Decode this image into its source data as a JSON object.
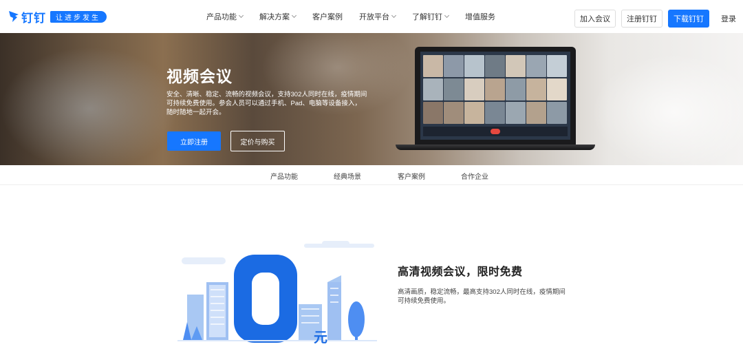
{
  "header": {
    "logo_text": "钉钉",
    "logo_slogan": "让进步发生",
    "nav": [
      "产品功能",
      "解决方案",
      "客户案例",
      "开放平台",
      "了解钉钉",
      "增值服务"
    ],
    "nav_has_dropdown": [
      true,
      true,
      false,
      true,
      true,
      false
    ],
    "join_meeting": "加入会议",
    "register": "注册钉钉",
    "download": "下载钉钉",
    "login": "登录"
  },
  "hero": {
    "title": "视频会议",
    "description": "安全、清晰、稳定、流畅的视频会议，支持302人同时在线，疫情期间可持续免费使用。参会人员可以通过手机、Pad、电脑等设备接入，随时随地一起开会。",
    "primary_button": "立即注册",
    "secondary_button": "定价与购买"
  },
  "subnav": [
    "产品功能",
    "经典场景",
    "客户案例",
    "合作企业"
  ],
  "feature": {
    "title": "高清视频会议，限时免费",
    "description": "高清画质，稳定流畅，最高支持302人同时在线，疫情期间可持续免费使用。",
    "illustration_number": "0",
    "illustration_unit": "元"
  },
  "colors": {
    "brand": "#1677ff"
  }
}
